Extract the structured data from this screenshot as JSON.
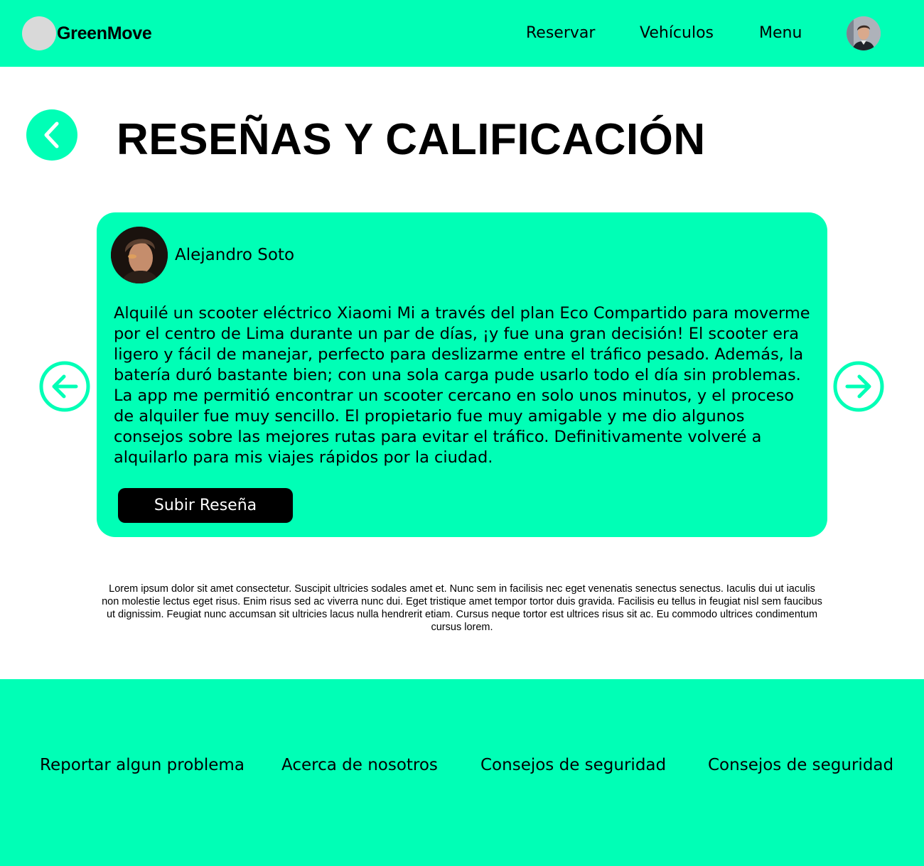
{
  "header": {
    "brand": "GreenMove",
    "nav": [
      "Reservar",
      "Vehículos",
      "Menu"
    ]
  },
  "page": {
    "title": "RESEÑAS Y CALIFICACIÓN"
  },
  "review": {
    "author": "Alejandro Soto",
    "text": "Alquilé un scooter eléctrico Xiaomi Mi a través del plan Eco Compartido para moverme por el centro de Lima durante un par de días, ¡y fue una gran decisión! El scooter era ligero y fácil de manejar, perfecto para deslizarme entre el tráfico pesado. Además, la batería duró bastante bien; con una sola carga pude usarlo todo el día sin problemas. La app me permitió encontrar un scooter cercano en solo unos minutos, y el proceso de alquiler fue muy sencillo. El propietario fue muy amigable y me dio algunos consejos sobre las mejores rutas para evitar el tráfico. Definitivamente volveré a alquilarlo para mis viajes rápidos por la ciudad.",
    "submit_label": "Subir Reseña"
  },
  "lorem": "Lorem ipsum dolor sit amet consectetur. Suscipit ultricies sodales amet et. Nunc sem in facilisis nec eget venenatis senectus senectus. Iaculis dui ut iaculis non molestie lectus eget risus. Enim risus sed ac viverra nunc dui. Eget tristique amet tempor tortor duis gravida. Facilisis eu tellus in feugiat nisl sem faucibus ut dignissim. Feugiat nunc accumsan sit ultricies lacus nulla hendrerit etiam. Cursus neque tortor est ultrices risus sit ac. Eu commodo ultrices condimentum cursus lorem.",
  "footer": {
    "links": [
      "Reportar algun problema",
      "Acerca de nosotros",
      "Consejos de seguridad",
      "Consejos de seguridad"
    ]
  },
  "colors": {
    "accent": "#00ffb6",
    "button": "#000000"
  },
  "icons": {
    "back": "chevron-left-icon",
    "prev": "arrow-left-circle-icon",
    "next": "arrow-right-circle-icon"
  }
}
